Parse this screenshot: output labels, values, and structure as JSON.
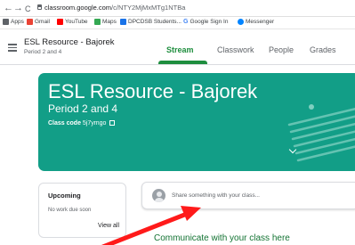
{
  "browser": {
    "back": "←",
    "forward": "→",
    "reload": "C",
    "url_host": "classroom.google.com",
    "url_path": "/c/NTY2MjMxMTg1NTBa"
  },
  "bookmarks": [
    {
      "label": "Apps",
      "icon": "apps-grid-icon",
      "color": "#4285f4"
    },
    {
      "label": "Gmail",
      "icon": "gmail-icon",
      "color": "#ea4335"
    },
    {
      "label": "YouTube",
      "icon": "youtube-icon",
      "color": "#ff0000"
    },
    {
      "label": "Maps",
      "icon": "maps-icon",
      "color": "#34a853"
    },
    {
      "label": "DPCDSB Students...",
      "icon": "school-icon",
      "color": "#1a73e8"
    },
    {
      "label": "Google Sign In",
      "icon": "google-icon",
      "color": "#4285f4"
    },
    {
      "label": "Messenger",
      "icon": "messenger-icon",
      "color": "#0084ff"
    }
  ],
  "header": {
    "class_title": "ESL Resource - Bajorek",
    "class_subtitle": "Period 2 and 4",
    "tabs": [
      "Stream",
      "Classwork",
      "People",
      "Grades"
    ],
    "active_tab": "Stream"
  },
  "banner": {
    "title": "ESL Resource - Bajorek",
    "subtitle": "Period 2 and 4",
    "code_label": "Class code",
    "code_value": "5j7ymgo",
    "color": "#129e87"
  },
  "upcoming": {
    "title": "Upcoming",
    "empty_text": "No work due soon",
    "view_all": "View all"
  },
  "share": {
    "placeholder": "Share something with your class..."
  },
  "annotation": {
    "text": "Communicate with your class here",
    "arrow_color": "#ff1a1a"
  }
}
